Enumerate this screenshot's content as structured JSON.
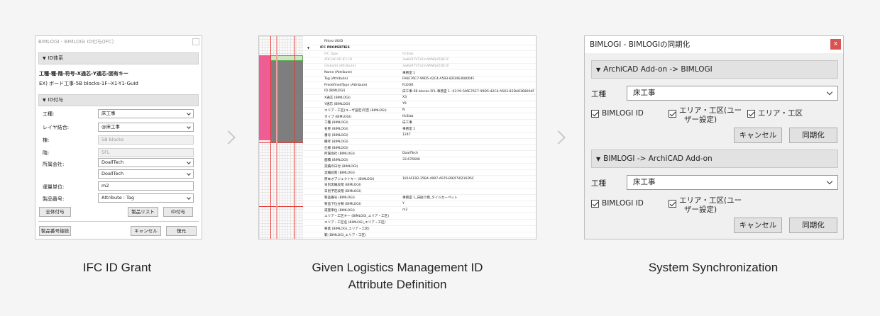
{
  "captions": {
    "left": "IFC ID Grant",
    "middle_line1": "Given Logistics Management ID",
    "middle_line2": "Attribute Definition",
    "right": "System Synchronization"
  },
  "panel1": {
    "title": "BIMLOGI - BIMLOGI ID付与(IFC)",
    "section_id_system": "ID体系",
    "id_format": "工種-種-階-符号-X通芯-Y通芯-固有キー",
    "id_example": "EX) ボード工事-5B blocks-1F--X1-Y1-Guid",
    "section_id_grant": "ID付与",
    "fields": [
      {
        "label": "工種:",
        "value": "床工事",
        "type": "select"
      },
      {
        "label": "レイヤ結合:",
        "value": "@床工事",
        "type": "select"
      },
      {
        "label": "棟:",
        "value": "5B blocks",
        "type": "disabled"
      },
      {
        "label": "階:",
        "value": "5FL",
        "type": "disabled"
      },
      {
        "label": "所属会社:",
        "value": "DoallTech",
        "type": "select"
      },
      {
        "label": "",
        "value": "DoallTech",
        "type": "select"
      },
      {
        "label": "運量単位:",
        "value": "m2",
        "type": "text"
      },
      {
        "label": "製品番号:",
        "value": "Attribute : Tag",
        "type": "select"
      }
    ],
    "buttons": {
      "grant_all": "全体付与",
      "product_list": "製品リスト",
      "grant_id": "ID付与",
      "link_product_number": "製品番号接続",
      "cancel": "キャンセル",
      "restore": "復元"
    }
  },
  "panel2": {
    "rows": [
      {
        "name": "Rhino UUID",
        "value": "",
        "style": "plain"
      },
      {
        "name": "IFC PROPERTIES",
        "value": "",
        "style": "header"
      },
      {
        "name": "IFC Type",
        "value": "IfcSlab",
        "style": "grey"
      },
      {
        "name": "ARCHICAD IFC ID",
        "value": "3wKeR7VTz2mAMWjHZQE1F",
        "style": "grey"
      },
      {
        "name": "GlobalId (Attribute)",
        "value": "3wKeR7VTz2mAMWjHZQE1F",
        "style": "grey"
      },
      {
        "name": "Name (Attribute)",
        "value": "事務室 1",
        "style": "plain"
      },
      {
        "name": "Tag (Attribute)",
        "value": "FA6E76C7-99D5-42C4-A593-82D46368004F",
        "style": "plain"
      },
      {
        "name": "PredefinedType (Attribute)",
        "value": "FLOOR",
        "style": "plain"
      },
      {
        "name": "ID (BIMLOGI)",
        "value": "床工事-5B blocks-5FL-事務室 1 -X3-Y9-FA6E76C7-99D5-42C4-A593-82D46368004F",
        "style": "plain"
      },
      {
        "name": "X通芯 (BIMLOGI)",
        "value": "X3",
        "style": "plain"
      },
      {
        "name": "Y通芯 (BIMLOGI)",
        "value": "Y9",
        "style": "plain"
      },
      {
        "name": "エリア・工区(ユーザ設定)可否 (BIMLOGI)",
        "value": "N",
        "style": "plain"
      },
      {
        "name": "タイプ (BIMLOGI)",
        "value": "IfcSlab",
        "style": "plain"
      },
      {
        "name": "工種 (BIMLOGI)",
        "value": "床工事",
        "style": "plain"
      },
      {
        "name": "名称 (BIMLOGI)",
        "value": "事務室 1",
        "style": "plain"
      },
      {
        "name": "番号 (BIMLOGI)",
        "value": "1247",
        "style": "plain"
      },
      {
        "name": "備考 (BIMLOGI)",
        "value": "",
        "style": "plain"
      },
      {
        "name": "仕様 (BIMLOGI)",
        "value": "",
        "style": "plain"
      },
      {
        "name": "所属会社 (BIMLOGI)",
        "value": "DoallTech",
        "style": "plain"
      },
      {
        "name": "面積 (BIMLOGI)",
        "value": "33.676600",
        "style": "plain"
      },
      {
        "name": "実績の日付 (BIMLOGI)",
        "value": "",
        "style": "plain"
      },
      {
        "name": "実績段階 (BIMLOGI)",
        "value": "",
        "style": "plain"
      },
      {
        "name": "原本オブジェクトキー (BIMLOGI)",
        "value": "181AFE92-25B4-4907-A976-B92F50216D5C",
        "style": "plain"
      },
      {
        "name": "日別実績段階 (BIMLOGI)",
        "value": "",
        "style": "plain"
      },
      {
        "name": "日別予定段階 (BIMLOGI)",
        "value": "",
        "style": "plain"
      },
      {
        "name": "製品番号 (BIMLOGI)",
        "value": "事務室 1_床貼り物_タイルカーペット",
        "style": "plain"
      },
      {
        "name": "製品下位分類 (BIMLOGI)",
        "value": "Y",
        "style": "plain"
      },
      {
        "name": "運量単位 (BIMLOGI)",
        "value": "m2",
        "style": "plain"
      },
      {
        "name": "エリア・工区キー (BIMLOGI_エリア・工区)",
        "value": "",
        "style": "plain"
      },
      {
        "name": "エリア・工区名 (BIMLOGI_エリア・工区)",
        "value": "",
        "style": "plain"
      },
      {
        "name": "要素 (BIMLOGI_エリア・工区)",
        "value": "",
        "style": "plain"
      },
      {
        "name": "範 (BIMLOGI_エリア・工区)",
        "value": "",
        "style": "plain"
      }
    ]
  },
  "panel3": {
    "title": "BIMLOGI - BIMLOGIの同期化",
    "close": "x",
    "section1": "ArchiCAD Add-on -> BIMLOGI",
    "section2": "BIMLOGI -> ArchiCAD Add-on",
    "trade_label": "工種",
    "trade_value": "床工事",
    "chk_bimlogi_id": "BIMLOGI ID",
    "chk_area_user_1": "エリア・工区(ユー",
    "chk_area_user_2": "ザー設定)",
    "chk_area": "エリア・工区",
    "cancel": "キャンセル",
    "sync": "同期化"
  }
}
